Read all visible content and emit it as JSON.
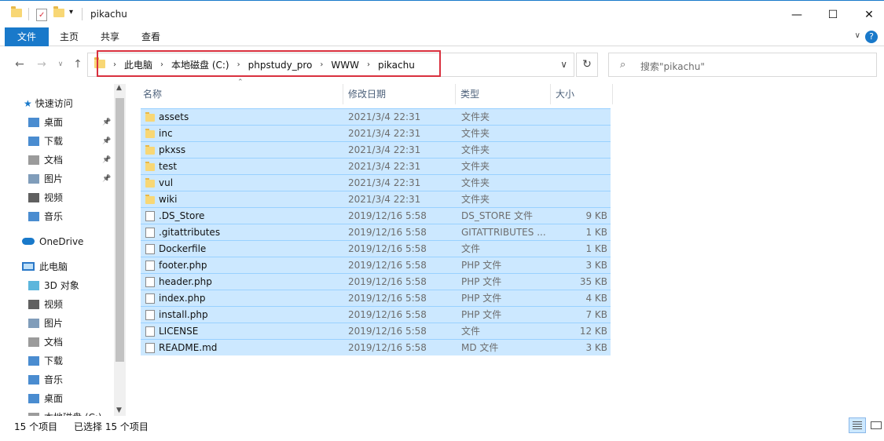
{
  "window": {
    "title": "pikachu",
    "minimize": "—",
    "maximize": "☐",
    "close": "✕"
  },
  "ribbon": {
    "tabs": [
      "文件",
      "主页",
      "共享",
      "查看"
    ],
    "help": "?"
  },
  "address": {
    "crumbs": [
      "此电脑",
      "本地磁盘 (C:)",
      "phpstudy_pro",
      "WWW",
      "pikachu"
    ],
    "highlight_color": "#d9303e"
  },
  "search": {
    "placeholder": "搜索\"pikachu\""
  },
  "nav": {
    "quick_access": "快速访问",
    "quick_items": [
      {
        "label": "桌面",
        "icon": "desktop-icon"
      },
      {
        "label": "下载",
        "icon": "download-icon"
      },
      {
        "label": "文档",
        "icon": "document-icon"
      },
      {
        "label": "图片",
        "icon": "pictures-icon"
      },
      {
        "label": "视频",
        "icon": "video-icon"
      },
      {
        "label": "音乐",
        "icon": "music-icon"
      }
    ],
    "onedrive": "OneDrive",
    "this_pc": "此电脑",
    "pc_items": [
      {
        "label": "3D 对象",
        "icon": "3d-objects-icon"
      },
      {
        "label": "视频",
        "icon": "video-icon"
      },
      {
        "label": "图片",
        "icon": "pictures-icon"
      },
      {
        "label": "文档",
        "icon": "document-icon"
      },
      {
        "label": "下载",
        "icon": "download-icon"
      },
      {
        "label": "音乐",
        "icon": "music-icon"
      },
      {
        "label": "桌面",
        "icon": "desktop-icon"
      },
      {
        "label": "本地磁盘 (C:)",
        "icon": "drive-icon"
      }
    ]
  },
  "columns": {
    "name": "名称",
    "date": "修改日期",
    "type": "类型",
    "size": "大小"
  },
  "files": [
    {
      "name": "assets",
      "date": "2021/3/4 22:31",
      "type": "文件夹",
      "size": "",
      "kind": "folder"
    },
    {
      "name": "inc",
      "date": "2021/3/4 22:31",
      "type": "文件夹",
      "size": "",
      "kind": "folder"
    },
    {
      "name": "pkxss",
      "date": "2021/3/4 22:31",
      "type": "文件夹",
      "size": "",
      "kind": "folder"
    },
    {
      "name": "test",
      "date": "2021/3/4 22:31",
      "type": "文件夹",
      "size": "",
      "kind": "folder"
    },
    {
      "name": "vul",
      "date": "2021/3/4 22:31",
      "type": "文件夹",
      "size": "",
      "kind": "folder"
    },
    {
      "name": "wiki",
      "date": "2021/3/4 22:31",
      "type": "文件夹",
      "size": "",
      "kind": "folder"
    },
    {
      "name": ".DS_Store",
      "date": "2019/12/16 5:58",
      "type": "DS_STORE 文件",
      "size": "9 KB",
      "kind": "file"
    },
    {
      "name": ".gitattributes",
      "date": "2019/12/16 5:58",
      "type": "GITATTRIBUTES ...",
      "size": "1 KB",
      "kind": "file"
    },
    {
      "name": "Dockerfile",
      "date": "2019/12/16 5:58",
      "type": "文件",
      "size": "1 KB",
      "kind": "file"
    },
    {
      "name": "footer.php",
      "date": "2019/12/16 5:58",
      "type": "PHP 文件",
      "size": "3 KB",
      "kind": "file"
    },
    {
      "name": "header.php",
      "date": "2019/12/16 5:58",
      "type": "PHP 文件",
      "size": "35 KB",
      "kind": "file"
    },
    {
      "name": "index.php",
      "date": "2019/12/16 5:58",
      "type": "PHP 文件",
      "size": "4 KB",
      "kind": "file"
    },
    {
      "name": "install.php",
      "date": "2019/12/16 5:58",
      "type": "PHP 文件",
      "size": "7 KB",
      "kind": "file"
    },
    {
      "name": "LICENSE",
      "date": "2019/12/16 5:58",
      "type": "文件",
      "size": "12 KB",
      "kind": "file"
    },
    {
      "name": "README.md",
      "date": "2019/12/16 5:58",
      "type": "MD 文件",
      "size": "3 KB",
      "kind": "file"
    }
  ],
  "status": {
    "count": "15 个项目",
    "selected": "已选择 15 个项目"
  },
  "colors": {
    "accent": "#1979ca",
    "selection": "#cce8ff",
    "selection_border": "#99d1ff"
  }
}
